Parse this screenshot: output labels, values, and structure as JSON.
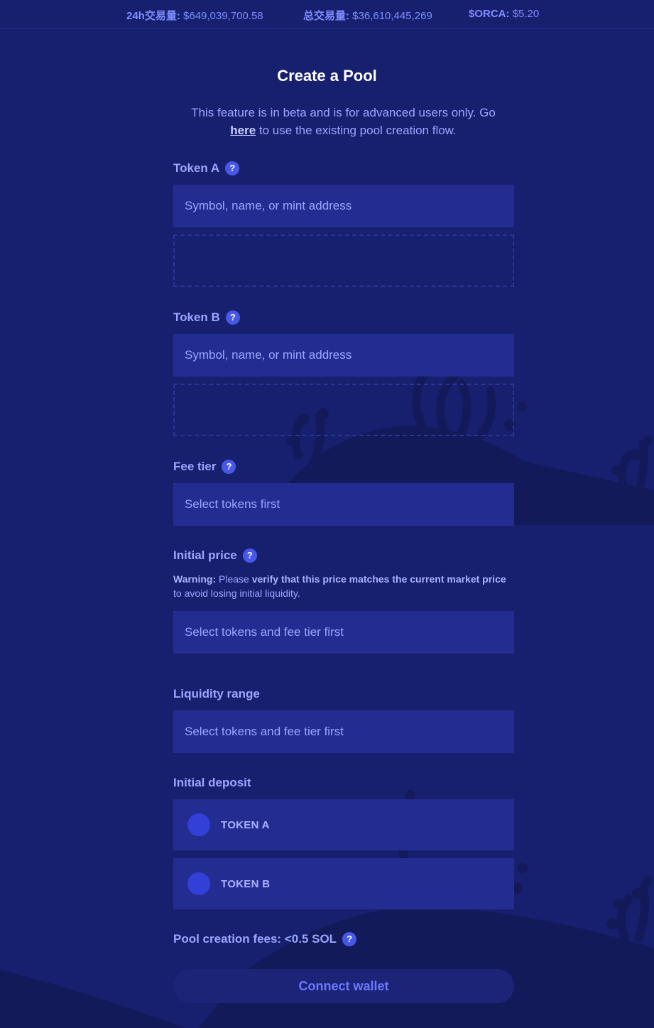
{
  "stats": [
    {
      "label": "24h交易量:",
      "value": "$649,039,700.58"
    },
    {
      "label": "总交易量:",
      "value": "$36,610,445,269"
    },
    {
      "label": "$ORCA:",
      "value": "$5.20"
    }
  ],
  "title": "Create a Pool",
  "beta": {
    "before": "This feature is in beta and is for advanced users only. Go",
    "link": "here",
    "after": "to use the existing pool creation flow."
  },
  "help_glyph": "?",
  "token_a": {
    "label": "Token A",
    "placeholder": "Symbol, name, or mint address"
  },
  "token_b": {
    "label": "Token B",
    "placeholder": "Symbol, name, or mint address"
  },
  "fee_tier": {
    "label": "Fee tier",
    "value": "Select tokens first"
  },
  "initial_price": {
    "label": "Initial price",
    "warning_title": "Warning:",
    "warning_t1": "Please",
    "warning_b1": "verify that this price matches the current market price",
    "warning_t2": "to avoid losing initial liquidity.",
    "value": "Select tokens and fee tier first"
  },
  "liquidity_range": {
    "label": "Liquidity range",
    "value": "Select tokens and fee tier first"
  },
  "initial_deposit": {
    "label": "Initial deposit",
    "token_a": "TOKEN A",
    "token_b": "TOKEN B"
  },
  "fees": {
    "label": "Pool creation fees: <0.5 SOL"
  },
  "connect_label": "Connect wallet",
  "colors": {
    "background": "#17206f",
    "field": "#232d91",
    "accent": "#4757e8",
    "text": "#9aa6ff"
  }
}
